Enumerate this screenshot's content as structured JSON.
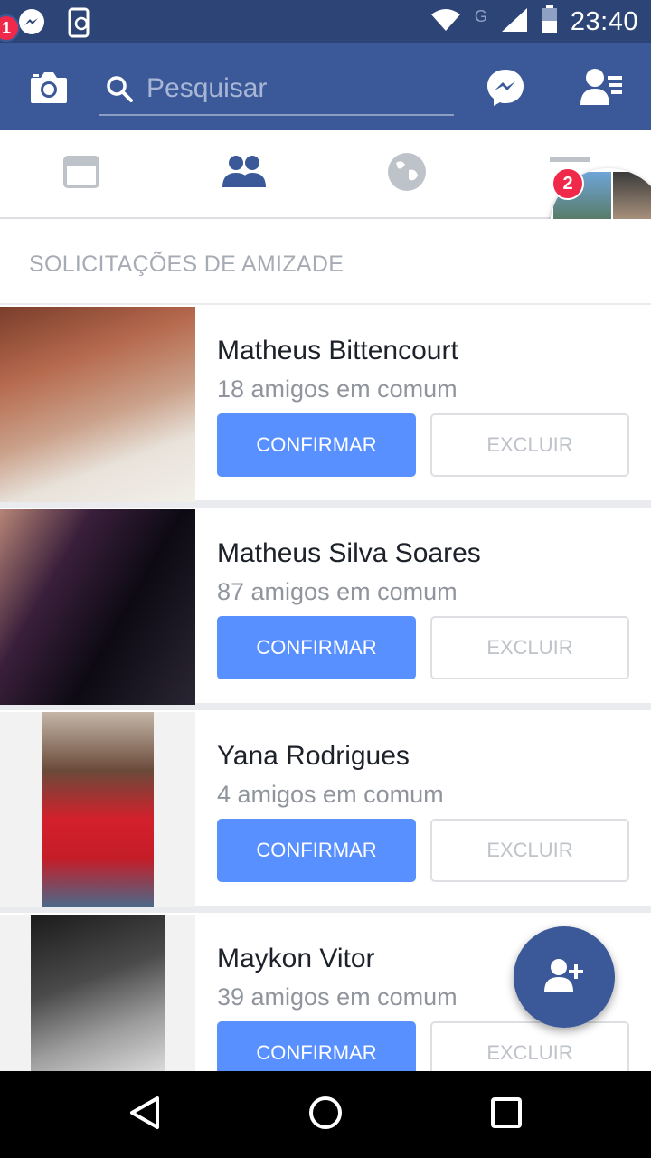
{
  "status_bar": {
    "time": "23:40",
    "network_label": "G",
    "icons": [
      "messenger-icon",
      "sync-phone-icon",
      "wifi-icon",
      "signal-icon",
      "battery-icon"
    ]
  },
  "header": {
    "search_placeholder": "Pesquisar",
    "messenger_badge": "1",
    "icons": [
      "camera-icon",
      "search-icon",
      "messenger-icon",
      "friends-menu-icon"
    ]
  },
  "tabs": [
    {
      "name": "news-feed",
      "icon": "news-feed-icon",
      "active": false
    },
    {
      "name": "friend-requests",
      "icon": "friends-icon",
      "active": true
    },
    {
      "name": "notifications",
      "icon": "globe-icon",
      "active": false
    },
    {
      "name": "menu",
      "icon": "menu-icon",
      "active": false
    }
  ],
  "chat_head": {
    "badge": "2"
  },
  "section_title": "SOLICITAÇÕES DE AMIZADE",
  "requests": [
    {
      "name": "Matheus Bittencourt",
      "mutual": "18 amigos em comum",
      "confirm": "CONFIRMAR",
      "delete": "EXCLUIR"
    },
    {
      "name": "Matheus Silva Soares",
      "mutual": "87 amigos em comum",
      "confirm": "CONFIRMAR",
      "delete": "EXCLUIR"
    },
    {
      "name": "Yana Rodrigues",
      "mutual": "4 amigos em comum",
      "confirm": "CONFIRMAR",
      "delete": "EXCLUIR"
    },
    {
      "name": "Maykon Vitor",
      "mutual": "39 amigos em comum",
      "confirm": "CONFIRMAR",
      "delete": "EXCLUIR"
    }
  ],
  "colors": {
    "status_bar": "#2d4476",
    "header": "#3b5998",
    "confirm_button": "#5890ff",
    "badge": "#f02849",
    "active_tab": "#3b5998",
    "inactive_tab": "#bec3c9"
  }
}
